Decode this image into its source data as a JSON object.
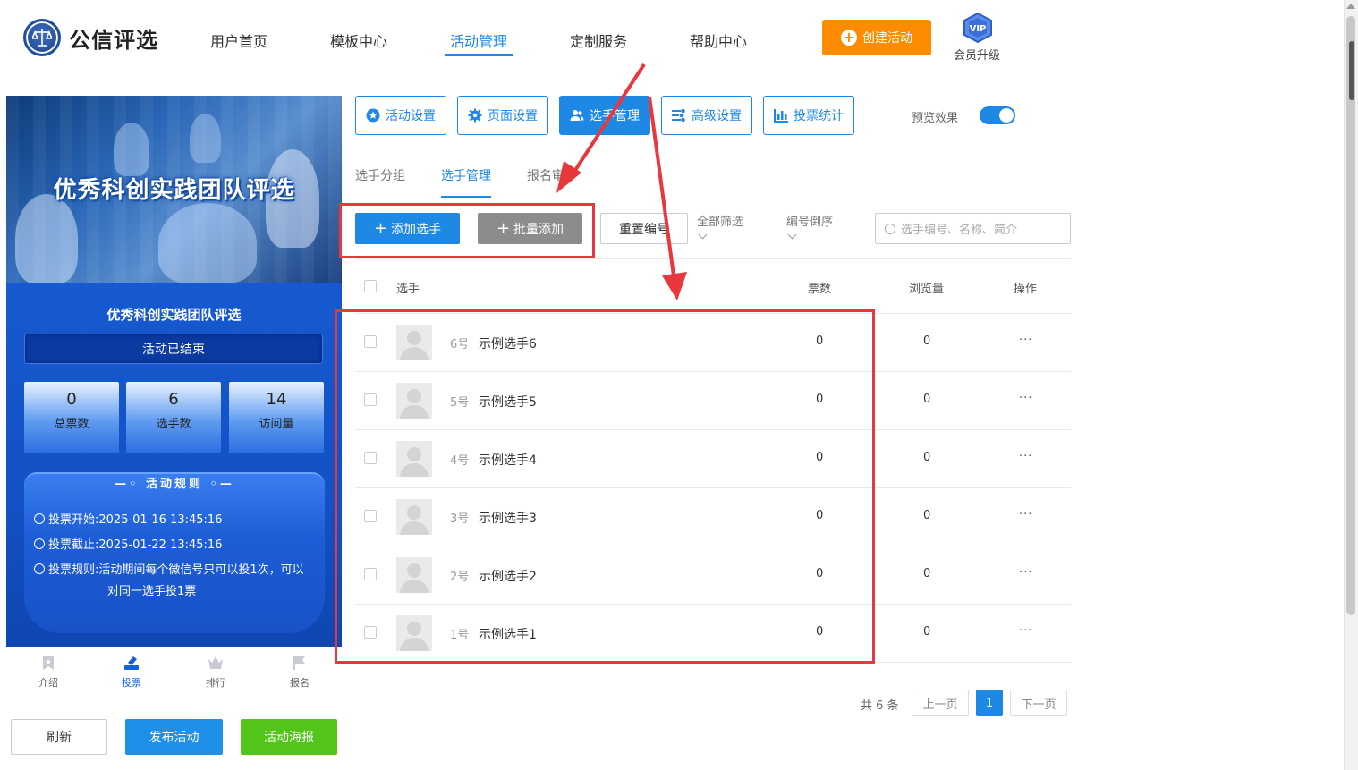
{
  "header": {
    "logo_text": "公信评选",
    "nav": [
      "用户首页",
      "模板中心",
      "活动管理",
      "定制服务",
      "帮助中心"
    ],
    "active_nav": "活动管理",
    "create_button": "创建活动",
    "vip_badge": "VIP",
    "vip_label": "会员升级"
  },
  "preview": {
    "banner_title": "优秀科创实践团队评选",
    "activity_title": "优秀科创实践团队评选",
    "status": "活动已结束",
    "stats": [
      {
        "value": "0",
        "label": "总票数"
      },
      {
        "value": "6",
        "label": "选手数"
      },
      {
        "value": "14",
        "label": "访问量"
      }
    ],
    "rules_title": "活动规则",
    "rules": [
      {
        "label": "投票开始:",
        "value": "2025-01-16 13:45:16"
      },
      {
        "label": "投票截止:",
        "value": "2025-01-22 13:45:16"
      },
      {
        "label": "投票规则:",
        "value": "活动期间每个微信号只可以投1次，可以",
        "value2": "对同一选手投1票"
      }
    ],
    "bottom_nav": [
      "介绍",
      "投票",
      "排行",
      "报名"
    ],
    "active_bottom_nav": "投票",
    "buttons": {
      "refresh": "刷新",
      "publish": "发布活动",
      "poster": "活动海报"
    }
  },
  "toolbar": {
    "buttons": [
      "活动设置",
      "页面设置",
      "选手管理",
      "高级设置",
      "投票统计"
    ],
    "active": "选手管理",
    "preview_label": "预览效果",
    "preview_on": true
  },
  "subtabs": [
    "选手分组",
    "选手管理",
    "报名审"
  ],
  "active_subtab": "选手管理",
  "actions": {
    "add": "添加选手",
    "batch_add": "批量添加",
    "reset_numbers": "重置编号",
    "filter_all": "全部筛选",
    "sort_number": "编号倒序",
    "search_placeholder": "选手编号、名称、简介"
  },
  "table": {
    "headers": {
      "player": "选手",
      "votes": "票数",
      "views": "浏览量",
      "ops": "操作"
    },
    "rows": [
      {
        "num": "6号",
        "name": "示例选手6",
        "votes": "0",
        "views": "0"
      },
      {
        "num": "5号",
        "name": "示例选手5",
        "votes": "0",
        "views": "0"
      },
      {
        "num": "4号",
        "name": "示例选手4",
        "votes": "0",
        "views": "0"
      },
      {
        "num": "3号",
        "name": "示例选手3",
        "votes": "0",
        "views": "0"
      },
      {
        "num": "2号",
        "name": "示例选手2",
        "votes": "0",
        "views": "0"
      },
      {
        "num": "1号",
        "name": "示例选手1",
        "votes": "0",
        "views": "0"
      }
    ],
    "more_glyph": "···"
  },
  "pagination": {
    "total": "共 6 条",
    "prev": "上一页",
    "current": "1",
    "next": "下一页"
  },
  "colors": {
    "accent": "#1e88e5",
    "create": "#ff8c00",
    "poster": "#52c41a",
    "annotation": "#e8383d"
  }
}
